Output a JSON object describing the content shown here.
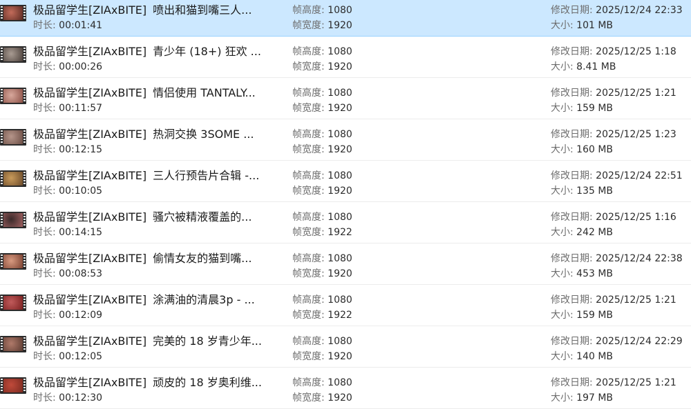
{
  "labels": {
    "duration": "时长: ",
    "height": "帧高度: ",
    "width": "帧宽度: ",
    "modified": "修改日期: ",
    "size": "大小: "
  },
  "colors": {
    "selected_bg": "#cce8ff",
    "selected_border": "#99d1ff"
  },
  "files": [
    {
      "prefix": "极品留学生[ZIAxBITE]",
      "name": "喷出和猫到嘴三人...",
      "duration": "00:01:41",
      "height": "1080",
      "width": "1920",
      "modified": "2025/12/24 22:33",
      "size": "101 MB",
      "selected": true
    },
    {
      "prefix": "极品留学生[ZIAxBITE]",
      "name": "青少年 (18+) 狂欢 ...",
      "duration": "00:00:26",
      "height": "1080",
      "width": "1920",
      "modified": "2025/12/25 1:18",
      "size": "8.41 MB"
    },
    {
      "prefix": "极品留学生[ZIAxBITE]",
      "name": "情侣使用 TANTALY...",
      "duration": "00:11:57",
      "height": "1080",
      "width": "1920",
      "modified": "2025/12/25 1:21",
      "size": "159 MB"
    },
    {
      "prefix": "极品留学生[ZIAxBITE]",
      "name": "热洞交换 3SOME ...",
      "duration": "00:12:15",
      "height": "1080",
      "width": "1920",
      "modified": "2025/12/25 1:23",
      "size": "160 MB"
    },
    {
      "prefix": "极品留学生[ZIAxBITE]",
      "name": "三人行预告片合辑 -...",
      "duration": "00:10:05",
      "height": "1080",
      "width": "1920",
      "modified": "2025/12/24 22:51",
      "size": "135 MB"
    },
    {
      "prefix": "极品留学生[ZIAxBITE]",
      "name": "骚穴被精液覆盖的...",
      "duration": "00:14:15",
      "height": "1080",
      "width": "1922",
      "modified": "2025/12/25 1:16",
      "size": "242 MB"
    },
    {
      "prefix": "极品留学生[ZIAxBITE]",
      "name": "偷情女友的猫到嘴...",
      "duration": "00:08:53",
      "height": "1080",
      "width": "1920",
      "modified": "2025/12/24 22:38",
      "size": "453 MB"
    },
    {
      "prefix": "极品留学生[ZIAxBITE]",
      "name": "涂满油的清晨3p - ...",
      "duration": "00:12:09",
      "height": "1080",
      "width": "1922",
      "modified": "2025/12/25 1:21",
      "size": "159 MB"
    },
    {
      "prefix": "极品留学生[ZIAxBITE]",
      "name": "完美的 18 岁青少年...",
      "duration": "00:12:05",
      "height": "1080",
      "width": "1920",
      "modified": "2025/12/24 22:29",
      "size": "140 MB"
    },
    {
      "prefix": "极品留学生[ZIAxBITE]",
      "name": "顽皮的 18 岁奥利维...",
      "duration": "00:12:30",
      "height": "1080",
      "width": "1920",
      "modified": "2025/12/25 1:21",
      "size": "197 MB"
    }
  ]
}
